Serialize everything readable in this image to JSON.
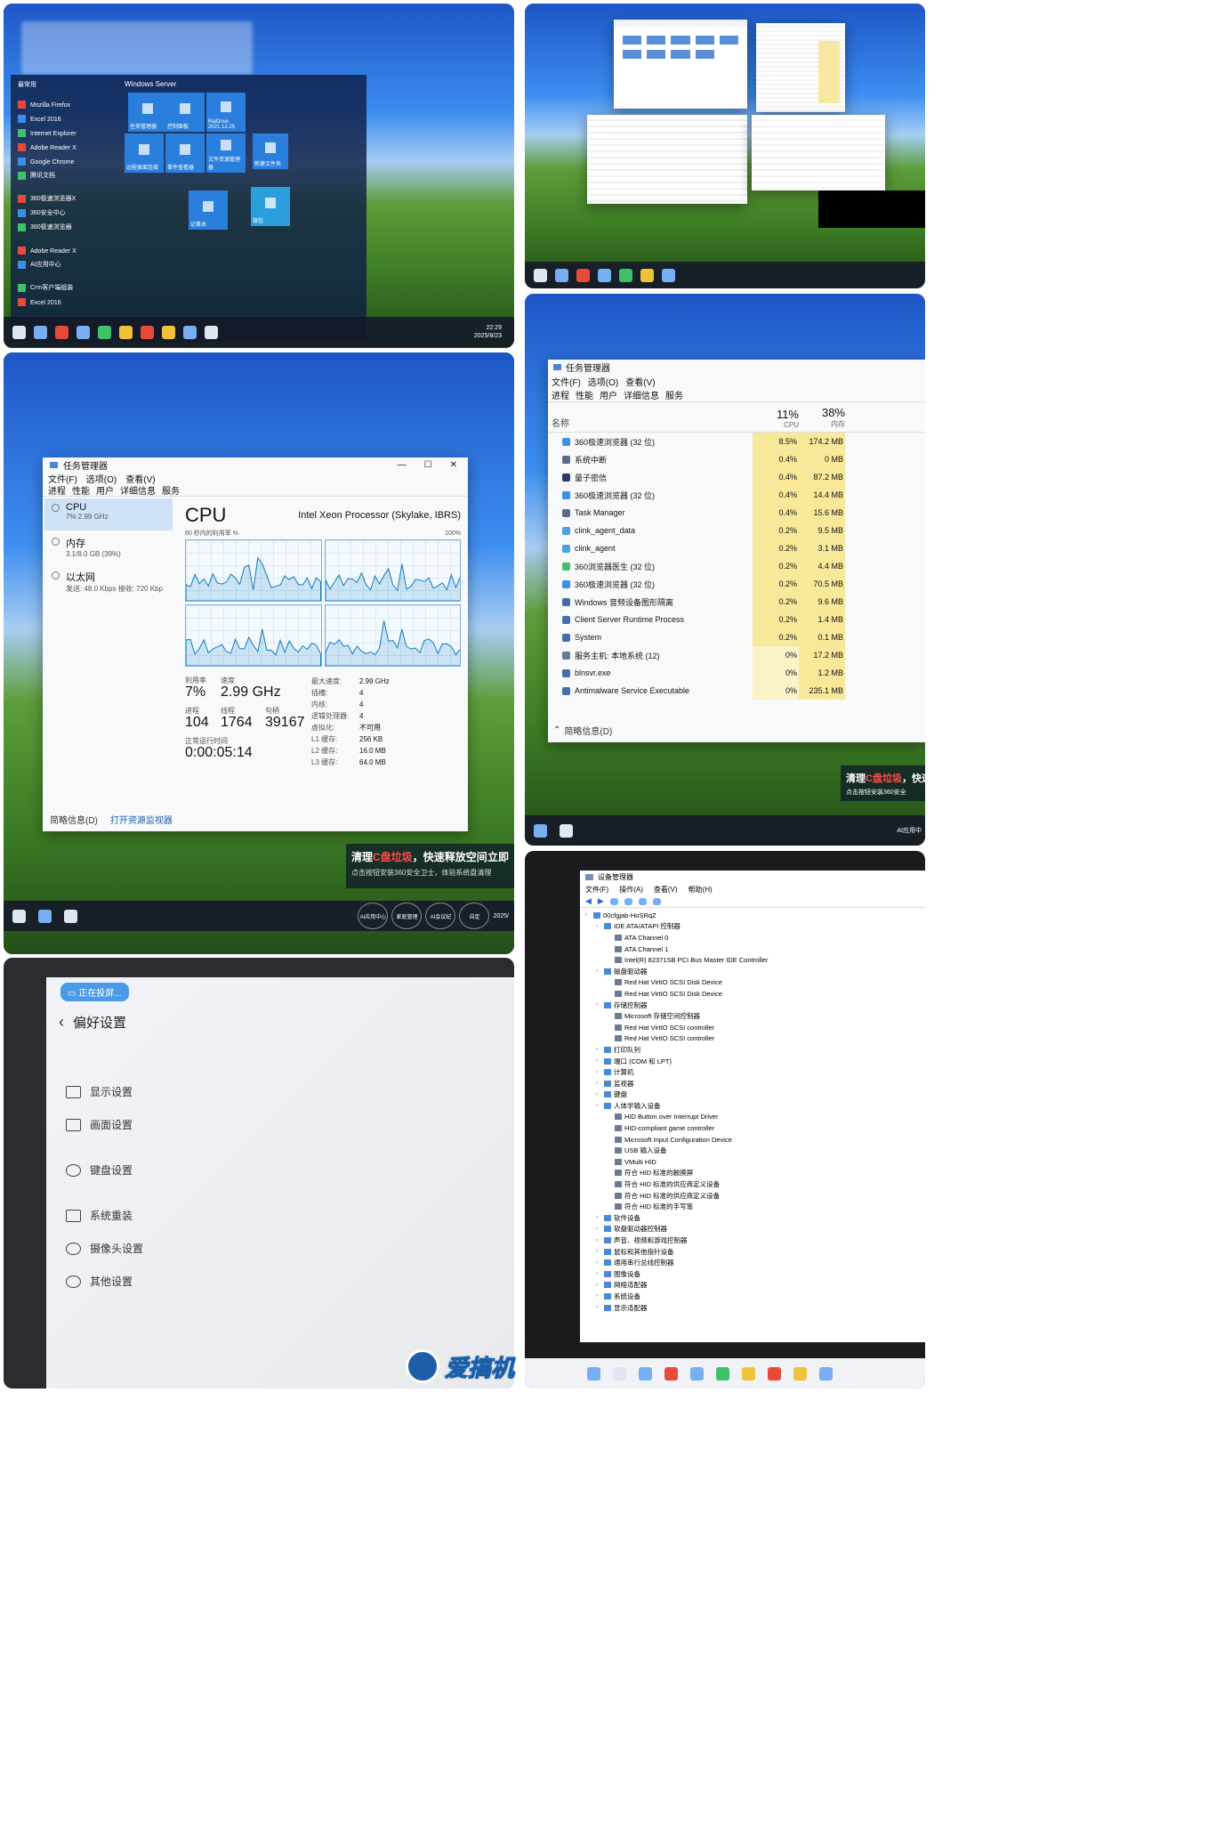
{
  "p1": {
    "start_header": "Windows Server",
    "list_section": "最常用",
    "apps": [
      "Mozilla Firefox",
      "Excel 2016",
      "Internet Explorer",
      "Adobe Reader X",
      "Google Chrome",
      "腾讯文档",
      "360极速浏览器X",
      "360安全中心",
      "360极速浏览器",
      "Adobe Reader X",
      "AI应用中心",
      "Crm客户端组装",
      "Excel 2016"
    ],
    "tiles": [
      {
        "label": "任务管理器",
        "color": "#2a7fdc"
      },
      {
        "label": "控制面板",
        "color": "#2a7fdc"
      },
      {
        "label": "RaiDrive 2021.12.25",
        "color": "#2a7fdc"
      },
      {
        "label": "远程桌面连接",
        "color": "#2a7fdc"
      },
      {
        "label": "事件查看器",
        "color": "#2a7fdc"
      },
      {
        "label": "文件资源管理器",
        "color": "#2a7fdc"
      },
      {
        "label": "新建文件夹",
        "color": "#2a7fdc"
      },
      {
        "label": "记事本",
        "color": "#2a7fdc"
      },
      {
        "label": "微信",
        "color": "#2a9fdc"
      }
    ],
    "clock_time": "22:29",
    "clock_date": "2025/8/23"
  },
  "p3": {
    "title": "任务管理器",
    "menu": [
      "文件(F)",
      "选项(O)",
      "查看(V)"
    ],
    "tabs": [
      "进程",
      "性能",
      "用户",
      "详细信息",
      "服务"
    ],
    "sidebar": [
      {
        "name": "CPU",
        "sub": "7% 2.99 GHz"
      },
      {
        "name": "内存",
        "sub": "3.1/8.0 GB (39%)"
      },
      {
        "name": "以太网",
        "sub": "发送: 48.0 Kbps 接收: 720 Kbp"
      }
    ],
    "cpu_title": "CPU",
    "cpu_model": "Intel Xeon Processor (Skylake, IBRS)",
    "graph_caption": "60 秒内的利用率 %",
    "graph_max": "100%",
    "stats_labels": {
      "util": "利用率",
      "speed": "速度",
      "proc": "进程",
      "threads": "线程",
      "handles": "句柄",
      "uptime": "正常运行时间"
    },
    "stats": {
      "util": "7%",
      "speed": "2.99 GHz",
      "proc": "104",
      "threads": "1764",
      "handles": "39167",
      "uptime": "0:00:05:14"
    },
    "specs": [
      {
        "k": "最大速度:",
        "v": "2.99 GHz"
      },
      {
        "k": "插槽:",
        "v": "4"
      },
      {
        "k": "内核:",
        "v": "4"
      },
      {
        "k": "逻辑处理器:",
        "v": "4"
      },
      {
        "k": "虚拟化:",
        "v": "不可用"
      },
      {
        "k": "L1 缓存:",
        "v": "256 KB"
      },
      {
        "k": "L2 缓存:",
        "v": "16.0 MB"
      },
      {
        "k": "L3 缓存:",
        "v": "64.0 MB"
      }
    ],
    "footer_less": "简略信息(D)",
    "footer_monitor": "打开资源监视器",
    "notif_title_a": "清理",
    "notif_title_b": "C盘垃圾",
    "notif_title_c": "，快速释放空间",
    "notif_btn": "立即",
    "notif_sub": "点击按钮安装360安全卫士，体验系统盘清理",
    "tray": [
      "AI应用中心",
      "家庭管理",
      "AI会议纪",
      "自定"
    ],
    "clock": "2025/"
  },
  "p4": {
    "title": "任务管理器",
    "menu": [
      "文件(F)",
      "选项(O)",
      "查看(V)"
    ],
    "tabs": [
      "进程",
      "性能",
      "用户",
      "详细信息",
      "服务"
    ],
    "col_name": "名称",
    "cpu_total": "11%",
    "cpu_label": "CPU",
    "mem_total": "38%",
    "mem_label": "内存",
    "processes": [
      {
        "name": "360极速浏览器 (32 位)",
        "cpu": "8.5%",
        "mem": "174.2 MB"
      },
      {
        "name": "系统中断",
        "cpu": "0.4%",
        "mem": "0 MB"
      },
      {
        "name": "量子密信",
        "cpu": "0.4%",
        "mem": "87.2 MB"
      },
      {
        "name": "360极速浏览器 (32 位)",
        "cpu": "0.4%",
        "mem": "14.4 MB"
      },
      {
        "name": "Task Manager",
        "cpu": "0.4%",
        "mem": "15.6 MB"
      },
      {
        "name": "clink_agent_data",
        "cpu": "0.2%",
        "mem": "9.5 MB"
      },
      {
        "name": "clink_agent",
        "cpu": "0.2%",
        "mem": "3.1 MB"
      },
      {
        "name": "360浏览器医生 (32 位)",
        "cpu": "0.2%",
        "mem": "4.4 MB"
      },
      {
        "name": "360极速浏览器 (32 位)",
        "cpu": "0.2%",
        "mem": "70.5 MB"
      },
      {
        "name": "Windows 音频设备图形隔离",
        "cpu": "0.2%",
        "mem": "9.6 MB"
      },
      {
        "name": "Client Server Runtime Process",
        "cpu": "0.2%",
        "mem": "1.4 MB"
      },
      {
        "name": "System",
        "cpu": "0.2%",
        "mem": "0.1 MB"
      },
      {
        "name": "服务主机: 本地系统 (12)",
        "cpu": "0%",
        "mem": "17.2 MB"
      },
      {
        "name": "blnsvr.exe",
        "cpu": "0%",
        "mem": "1.2 MB"
      },
      {
        "name": "Antimalware Service Executable",
        "cpu": "0%",
        "mem": "235.1 MB"
      }
    ],
    "footer": "简略信息(D)",
    "notif_a": "清理",
    "notif_b": "C盘垃圾",
    "notif_c": "，快速",
    "notif_sub": "点击按钮安装360安全",
    "tray": "AI应用中"
  },
  "p5": {
    "badge": "正在投屏...",
    "title": "偏好设置",
    "items": [
      {
        "label": "显示设置",
        "icon": "monitor-icon"
      },
      {
        "label": "画面设置",
        "icon": "frame-icon"
      },
      {
        "label": "键盘设置",
        "icon": "keyboard-icon"
      },
      {
        "label": "系统重装",
        "icon": "reinstall-icon"
      },
      {
        "label": "摄像头设置",
        "icon": "camera-icon"
      },
      {
        "label": "其他设置",
        "icon": "gear-icon"
      }
    ]
  },
  "p6": {
    "title": "设备管理器",
    "menu": [
      "文件(F)",
      "操作(A)",
      "查看(V)",
      "帮助(H)"
    ],
    "tree": [
      {
        "lvl": 0,
        "t": "00cfgjab-HoSRqZ"
      },
      {
        "lvl": 1,
        "t": "IDE ATA/ATAPI 控制器"
      },
      {
        "lvl": 2,
        "t": "ATA Channel 0"
      },
      {
        "lvl": 2,
        "t": "ATA Channel 1"
      },
      {
        "lvl": 2,
        "t": "Intel(R) 82371SB PCI Bus Master IDE Controller"
      },
      {
        "lvl": 1,
        "t": "磁盘驱动器"
      },
      {
        "lvl": 2,
        "t": "Red Hat VirtIO SCSI Disk Device"
      },
      {
        "lvl": 2,
        "t": "Red Hat VirtIO SCSI Disk Device"
      },
      {
        "lvl": 1,
        "t": "存储控制器"
      },
      {
        "lvl": 2,
        "t": "Microsoft 存储空间控制器"
      },
      {
        "lvl": 2,
        "t": "Red Hat VirtIO SCSI controller"
      },
      {
        "lvl": 2,
        "t": "Red Hat VirtIO SCSI controller"
      },
      {
        "lvl": 1,
        "t": "打印队列"
      },
      {
        "lvl": 1,
        "t": "端口 (COM 和 LPT)"
      },
      {
        "lvl": 1,
        "t": "计算机"
      },
      {
        "lvl": 1,
        "t": "监视器"
      },
      {
        "lvl": 1,
        "t": "键盘"
      },
      {
        "lvl": 1,
        "t": "人体学输入设备"
      },
      {
        "lvl": 2,
        "t": "HID Button over Interrupt Driver"
      },
      {
        "lvl": 2,
        "t": "HID-compliant game controller"
      },
      {
        "lvl": 2,
        "t": "Microsoft Input Configuration Device"
      },
      {
        "lvl": 2,
        "t": "USB 输入设备"
      },
      {
        "lvl": 2,
        "t": "VMulti HID"
      },
      {
        "lvl": 2,
        "t": "符合 HID 标准的触摸屏"
      },
      {
        "lvl": 2,
        "t": "符合 HID 标准的供应商定义设备"
      },
      {
        "lvl": 2,
        "t": "符合 HID 标准的供应商定义设备"
      },
      {
        "lvl": 2,
        "t": "符合 HID 标准的手写笔"
      },
      {
        "lvl": 1,
        "t": "软件设备"
      },
      {
        "lvl": 1,
        "t": "软盘驱动器控制器"
      },
      {
        "lvl": 1,
        "t": "声音、视频和游戏控制器"
      },
      {
        "lvl": 1,
        "t": "鼠标和其他指针设备"
      },
      {
        "lvl": 1,
        "t": "通用串行总线控制器"
      },
      {
        "lvl": 1,
        "t": "图像设备"
      },
      {
        "lvl": 1,
        "t": "网络适配器"
      },
      {
        "lvl": 1,
        "t": "系统设备"
      },
      {
        "lvl": 1,
        "t": "显示适配器"
      }
    ]
  },
  "watermark": "爱搞机"
}
